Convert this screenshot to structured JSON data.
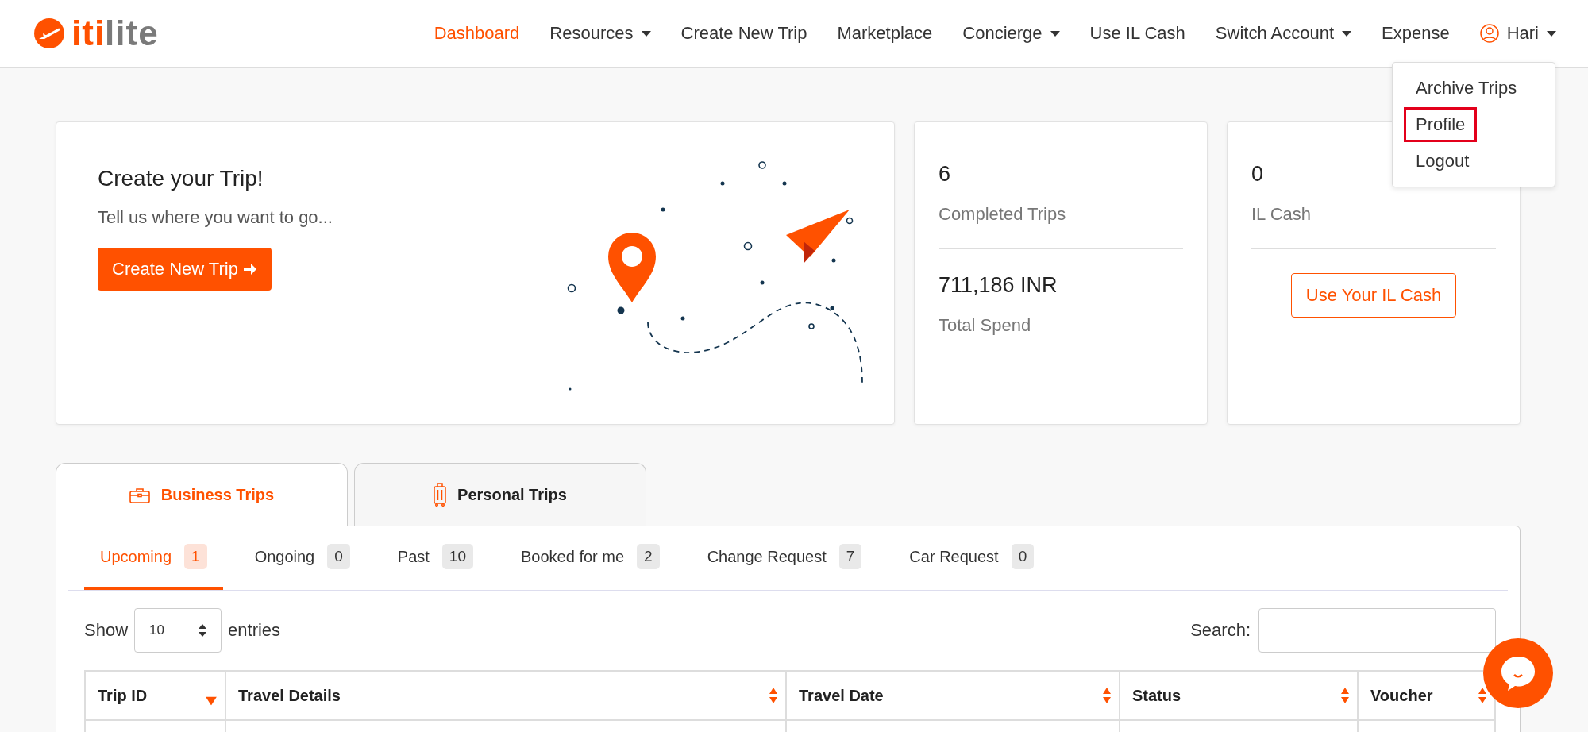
{
  "logo": {
    "accent": "iti",
    "rest": "lite"
  },
  "nav": [
    {
      "label": "Dashboard",
      "selected": true,
      "kind": "link"
    },
    {
      "label": "Resources",
      "selected": false,
      "kind": "dropdown"
    },
    {
      "label": "Create New Trip",
      "selected": false,
      "kind": "link"
    },
    {
      "label": "Marketplace",
      "selected": false,
      "kind": "link"
    },
    {
      "label": "Concierge",
      "selected": false,
      "kind": "dropdown"
    },
    {
      "label": "Use IL Cash",
      "selected": false,
      "kind": "link"
    },
    {
      "label": "Switch Account",
      "selected": false,
      "kind": "dropdown"
    },
    {
      "label": "Expense",
      "selected": false,
      "kind": "link"
    },
    {
      "label": "Hari",
      "selected": false,
      "kind": "user"
    }
  ],
  "user_menu": [
    {
      "label": "Archive Trips",
      "selected": false
    },
    {
      "label": "Profile",
      "selected": true
    },
    {
      "label": "Logout",
      "selected": false
    }
  ],
  "create_card": {
    "title": "Create your Trip!",
    "subtitle": "Tell us where you want to go...",
    "button": "Create New Trip"
  },
  "stats_card": {
    "count": "6",
    "count_label": "Completed Trips",
    "amount": "711,186 INR",
    "amount_label": "Total Spend"
  },
  "cash_card": {
    "amount": "0",
    "label": "IL Cash",
    "button": "Use Your IL Cash"
  },
  "trip_tabs": [
    {
      "label": "Business Trips",
      "selected": true,
      "kind": "business"
    },
    {
      "label": "Personal Trips",
      "selected": false,
      "kind": "personal"
    }
  ],
  "sub_tabs": [
    {
      "label": "Upcoming",
      "count": "1",
      "selected": true
    },
    {
      "label": "Ongoing",
      "count": "0",
      "selected": false
    },
    {
      "label": "Past",
      "count": "10",
      "selected": false
    },
    {
      "label": "Booked for me",
      "count": "2",
      "selected": false
    },
    {
      "label": "Change Request",
      "count": "7",
      "selected": false
    },
    {
      "label": "Car Request",
      "count": "0",
      "selected": false
    }
  ],
  "length": {
    "show": "Show",
    "value": "10",
    "entries": "entries"
  },
  "search": {
    "label": "Search:"
  },
  "table": {
    "columns": [
      {
        "label": "Trip ID",
        "sorted": true
      },
      {
        "label": "Travel Details",
        "sorted": false
      },
      {
        "label": "Travel Date",
        "sorted": false
      },
      {
        "label": "Status",
        "sorted": false
      },
      {
        "label": "Voucher",
        "sorted": false
      }
    ]
  }
}
